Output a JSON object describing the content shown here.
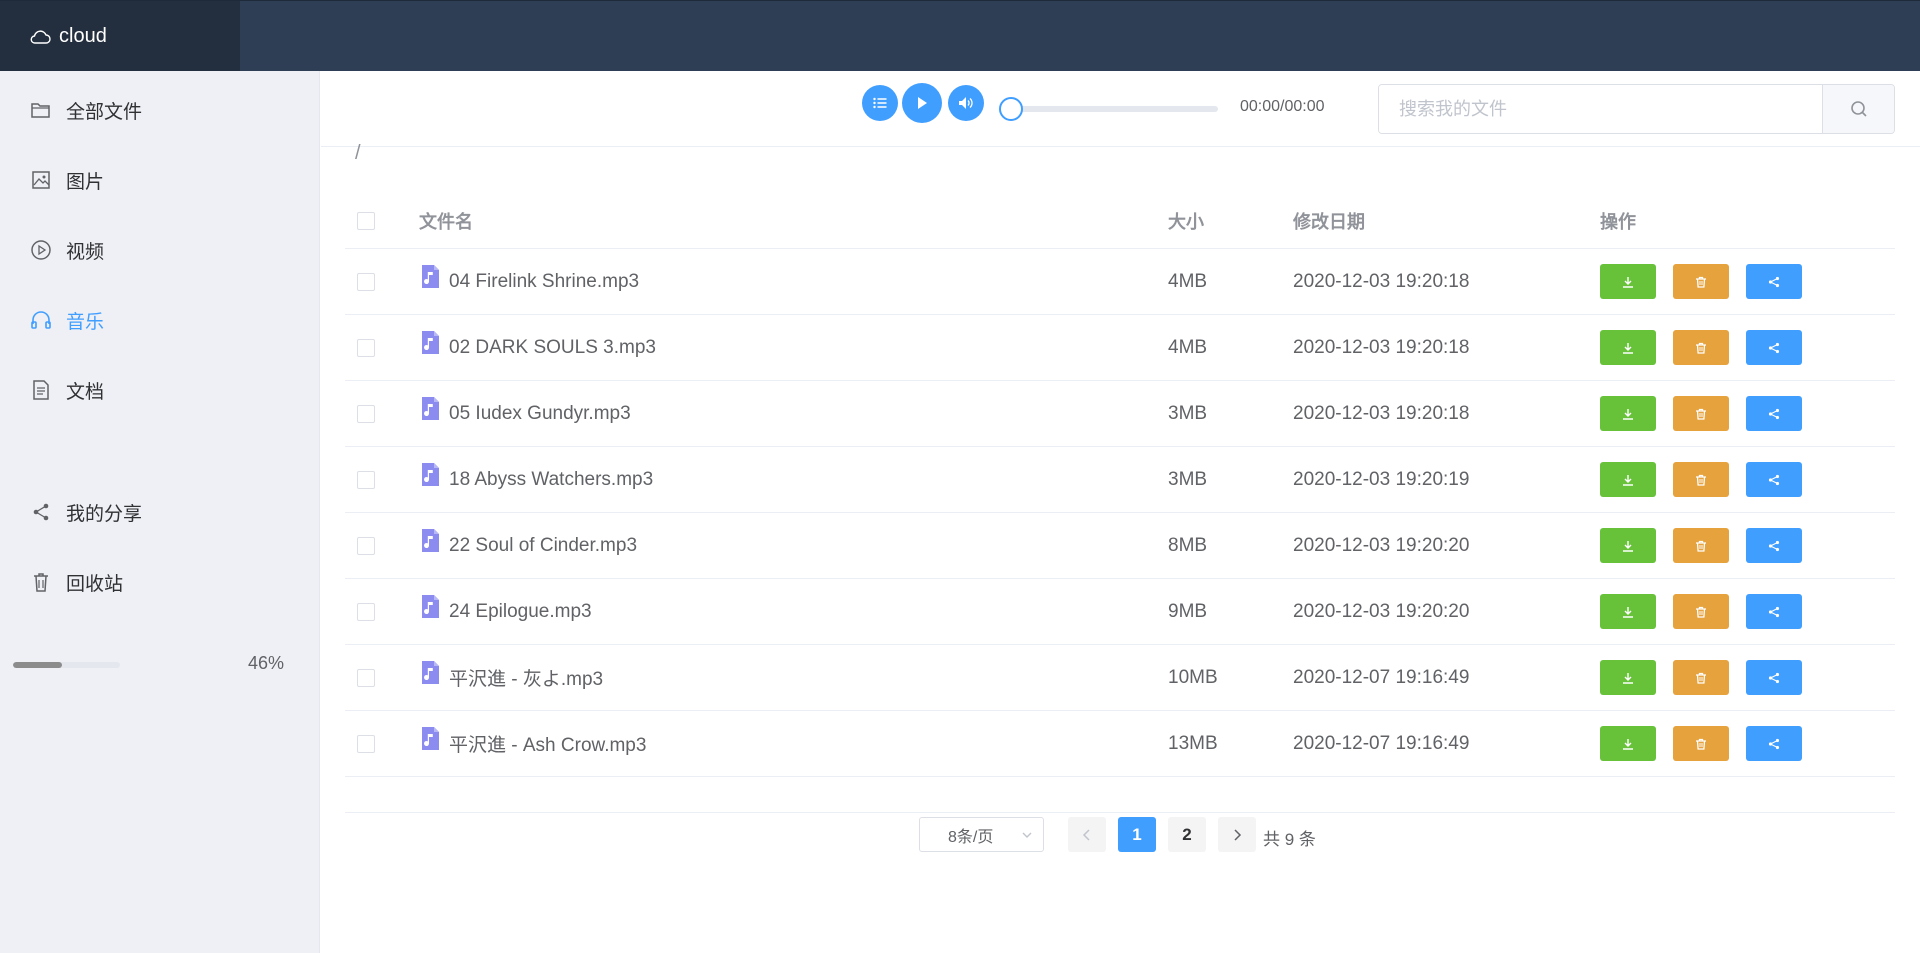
{
  "brand": {
    "name": "cloud"
  },
  "sidebar": {
    "items": [
      {
        "label": "全部文件",
        "icon": "folder-icon"
      },
      {
        "label": "图片",
        "icon": "image-icon"
      },
      {
        "label": "视频",
        "icon": "video-icon"
      },
      {
        "label": "音乐",
        "icon": "headphones-icon",
        "active": true
      },
      {
        "label": "文档",
        "icon": "document-icon"
      },
      {
        "label": "我的分享",
        "icon": "share-icon"
      },
      {
        "label": "回收站",
        "icon": "trash-icon"
      }
    ],
    "storage": {
      "percent_label": "46%",
      "fraction": 0.46
    }
  },
  "player": {
    "time": "00:00/00:00",
    "progress": 0
  },
  "search": {
    "placeholder": "搜索我的文件"
  },
  "breadcrumb": "/",
  "table": {
    "headers": {
      "name": "文件名",
      "size": "大小",
      "date": "修改日期",
      "ops": "操作"
    },
    "rows": [
      {
        "name": "04 Firelink Shrine.mp3",
        "size": "4MB",
        "date": "2020-12-03 19:20:18"
      },
      {
        "name": "02 DARK SOULS 3.mp3",
        "size": "4MB",
        "date": "2020-12-03 19:20:18"
      },
      {
        "name": "05 Iudex Gundyr.mp3",
        "size": "3MB",
        "date": "2020-12-03 19:20:18"
      },
      {
        "name": "18 Abyss Watchers.mp3",
        "size": "3MB",
        "date": "2020-12-03 19:20:19"
      },
      {
        "name": "22 Soul of Cinder.mp3",
        "size": "8MB",
        "date": "2020-12-03 19:20:20"
      },
      {
        "name": "24 Epilogue.mp3",
        "size": "9MB",
        "date": "2020-12-03 19:20:20"
      },
      {
        "name": "平沢進 - 灰よ.mp3",
        "size": "10MB",
        "date": "2020-12-07 19:16:49"
      },
      {
        "name": "平沢進 - Ash Crow.mp3",
        "size": "13MB",
        "date": "2020-12-07 19:16:49"
      }
    ]
  },
  "pagination": {
    "page_size": "8条/页",
    "pages": [
      "1",
      "2"
    ],
    "current": "1",
    "total": "共 9 条"
  },
  "colors": {
    "accent": "#409eff",
    "download": "#67c23a",
    "delete": "#e6a23c",
    "header": "#2e3e55"
  }
}
